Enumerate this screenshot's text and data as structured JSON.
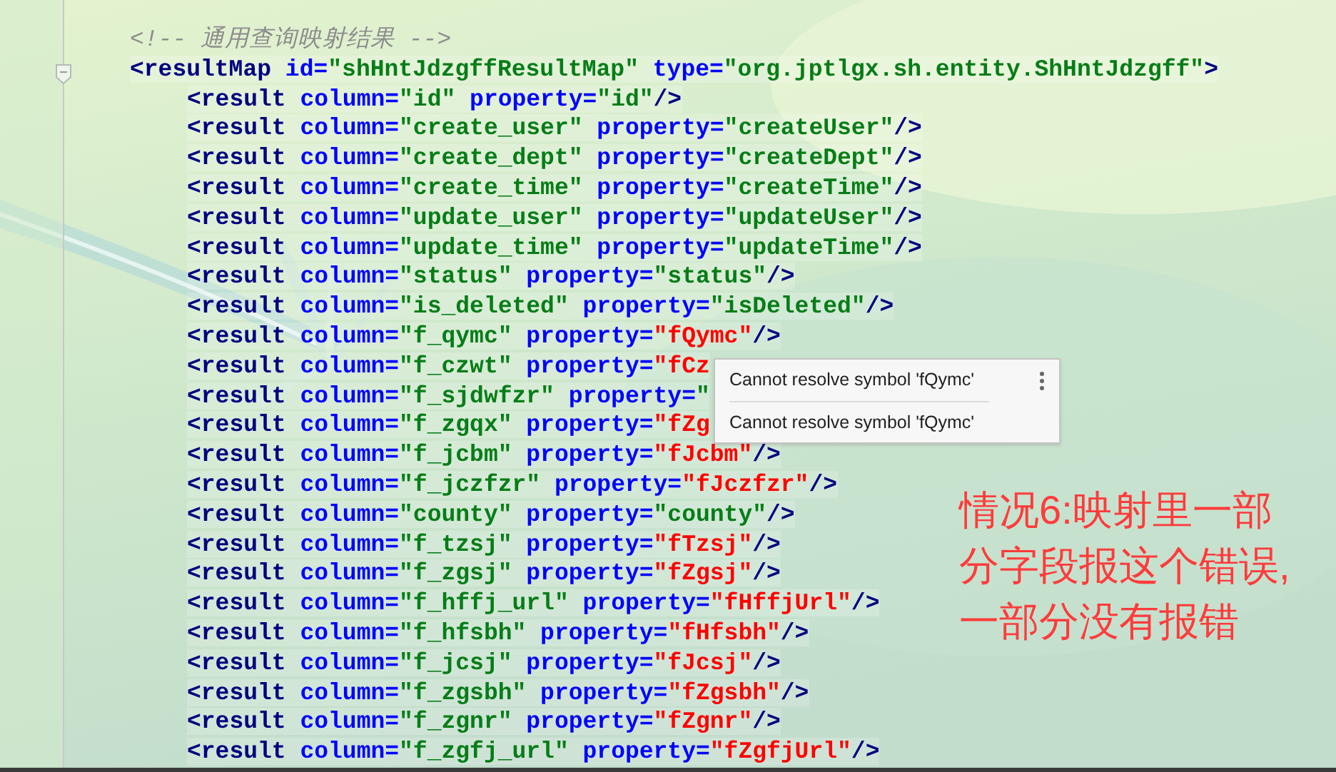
{
  "editor": {
    "comment": "<!-- 通用查询映射结果 -->",
    "result_map": {
      "tokens": [
        {
          "text": "<resultMap",
          "kind": "tag"
        },
        {
          "text": " id=",
          "kind": "attr"
        },
        {
          "text": "\"shHntJdzgffResultMap\"",
          "kind": "str"
        },
        {
          "text": " type=",
          "kind": "attr"
        },
        {
          "text": "\"org.jptlgx.sh.entity.ShHntJdzgff\"",
          "kind": "str"
        },
        {
          "text": ">",
          "kind": "tag"
        }
      ],
      "children": [
        {
          "tokens": [
            {
              "text": "<result",
              "kind": "tag"
            },
            {
              "text": " column=",
              "kind": "attr"
            },
            {
              "text": "\"id\"",
              "kind": "str"
            },
            {
              "text": " property=",
              "kind": "attr"
            },
            {
              "text": "\"id\"",
              "kind": "str"
            },
            {
              "text": "/>",
              "kind": "tag"
            }
          ]
        },
        {
          "tokens": [
            {
              "text": "<result",
              "kind": "tag"
            },
            {
              "text": " column=",
              "kind": "attr"
            },
            {
              "text": "\"create_user\"",
              "kind": "str"
            },
            {
              "text": " property=",
              "kind": "attr"
            },
            {
              "text": "\"createUser\"",
              "kind": "str"
            },
            {
              "text": "/>",
              "kind": "tag"
            }
          ]
        },
        {
          "tokens": [
            {
              "text": "<result",
              "kind": "tag"
            },
            {
              "text": " column=",
              "kind": "attr"
            },
            {
              "text": "\"create_dept\"",
              "kind": "str"
            },
            {
              "text": " property=",
              "kind": "attr"
            },
            {
              "text": "\"createDept\"",
              "kind": "str"
            },
            {
              "text": "/>",
              "kind": "tag"
            }
          ]
        },
        {
          "tokens": [
            {
              "text": "<result",
              "kind": "tag"
            },
            {
              "text": " column=",
              "kind": "attr"
            },
            {
              "text": "\"create_time\"",
              "kind": "str"
            },
            {
              "text": " property=",
              "kind": "attr"
            },
            {
              "text": "\"createTime\"",
              "kind": "str"
            },
            {
              "text": "/>",
              "kind": "tag"
            }
          ]
        },
        {
          "tokens": [
            {
              "text": "<result",
              "kind": "tag"
            },
            {
              "text": " column=",
              "kind": "attr"
            },
            {
              "text": "\"update_user\"",
              "kind": "str"
            },
            {
              "text": " property=",
              "kind": "attr"
            },
            {
              "text": "\"updateUser\"",
              "kind": "str"
            },
            {
              "text": "/>",
              "kind": "tag"
            }
          ]
        },
        {
          "tokens": [
            {
              "text": "<result",
              "kind": "tag"
            },
            {
              "text": " column=",
              "kind": "attr"
            },
            {
              "text": "\"update_time\"",
              "kind": "str"
            },
            {
              "text": " property=",
              "kind": "attr"
            },
            {
              "text": "\"updateTime\"",
              "kind": "str"
            },
            {
              "text": "/>",
              "kind": "tag"
            }
          ]
        },
        {
          "tokens": [
            {
              "text": "<result",
              "kind": "tag"
            },
            {
              "text": " column=",
              "kind": "attr"
            },
            {
              "text": "\"status\"",
              "kind": "str"
            },
            {
              "text": " property=",
              "kind": "attr"
            },
            {
              "text": "\"status\"",
              "kind": "str"
            },
            {
              "text": "/>",
              "kind": "tag"
            }
          ]
        },
        {
          "tokens": [
            {
              "text": "<result",
              "kind": "tag"
            },
            {
              "text": " column=",
              "kind": "attr"
            },
            {
              "text": "\"is_deleted\"",
              "kind": "str"
            },
            {
              "text": " property=",
              "kind": "attr"
            },
            {
              "text": "\"isDeleted\"",
              "kind": "str"
            },
            {
              "text": "/>",
              "kind": "tag"
            }
          ]
        },
        {
          "tokens": [
            {
              "text": "<result",
              "kind": "tag"
            },
            {
              "text": " column=",
              "kind": "attr"
            },
            {
              "text": "\"f_qymc\"",
              "kind": "str"
            },
            {
              "text": " property=",
              "kind": "attr"
            },
            {
              "text": "\"fQymc\"",
              "kind": "err"
            },
            {
              "text": "/>",
              "kind": "tag"
            }
          ]
        },
        {
          "tokens": [
            {
              "text": "<result",
              "kind": "tag"
            },
            {
              "text": " column=",
              "kind": "attr"
            },
            {
              "text": "\"f_czwt\"",
              "kind": "str"
            },
            {
              "text": " property=",
              "kind": "attr"
            },
            {
              "text": "\"fCz",
              "kind": "err"
            }
          ]
        },
        {
          "tokens": [
            {
              "text": "<result",
              "kind": "tag"
            },
            {
              "text": " column=",
              "kind": "attr"
            },
            {
              "text": "\"f_sjdwfzr\"",
              "kind": "str"
            },
            {
              "text": " property=",
              "kind": "attr"
            },
            {
              "text": "\"",
              "kind": "str"
            }
          ]
        },
        {
          "tokens": [
            {
              "text": "<result",
              "kind": "tag"
            },
            {
              "text": " column=",
              "kind": "attr"
            },
            {
              "text": "\"f_zgqx\"",
              "kind": "str"
            },
            {
              "text": " property=",
              "kind": "attr"
            },
            {
              "text": "\"fZg",
              "kind": "err"
            }
          ]
        },
        {
          "tokens": [
            {
              "text": "<result",
              "kind": "tag"
            },
            {
              "text": " column=",
              "kind": "attr"
            },
            {
              "text": "\"f_jcbm\"",
              "kind": "str"
            },
            {
              "text": " property=",
              "kind": "attr"
            },
            {
              "text": "\"fJcbm\"",
              "kind": "err"
            },
            {
              "text": "/>",
              "kind": "tag"
            }
          ]
        },
        {
          "tokens": [
            {
              "text": "<result",
              "kind": "tag"
            },
            {
              "text": " column=",
              "kind": "attr"
            },
            {
              "text": "\"f_jczfzr\"",
              "kind": "str"
            },
            {
              "text": " property=",
              "kind": "attr"
            },
            {
              "text": "\"fJczfzr\"",
              "kind": "err"
            },
            {
              "text": "/>",
              "kind": "tag"
            }
          ]
        },
        {
          "tokens": [
            {
              "text": "<result",
              "kind": "tag"
            },
            {
              "text": " column=",
              "kind": "attr"
            },
            {
              "text": "\"county\"",
              "kind": "str"
            },
            {
              "text": " property=",
              "kind": "attr"
            },
            {
              "text": "\"county\"",
              "kind": "str"
            },
            {
              "text": "/>",
              "kind": "tag"
            }
          ]
        },
        {
          "tokens": [
            {
              "text": "<result",
              "kind": "tag"
            },
            {
              "text": " column=",
              "kind": "attr"
            },
            {
              "text": "\"f_tzsj\"",
              "kind": "str"
            },
            {
              "text": " property=",
              "kind": "attr"
            },
            {
              "text": "\"fTzsj\"",
              "kind": "err"
            },
            {
              "text": "/>",
              "kind": "tag"
            }
          ]
        },
        {
          "tokens": [
            {
              "text": "<result",
              "kind": "tag"
            },
            {
              "text": " column=",
              "kind": "attr"
            },
            {
              "text": "\"f_zgsj\"",
              "kind": "str"
            },
            {
              "text": " property=",
              "kind": "attr"
            },
            {
              "text": "\"fZgsj\"",
              "kind": "err"
            },
            {
              "text": "/>",
              "kind": "tag"
            }
          ]
        },
        {
          "tokens": [
            {
              "text": "<result",
              "kind": "tag"
            },
            {
              "text": " column=",
              "kind": "attr"
            },
            {
              "text": "\"f_hffj_url\"",
              "kind": "str"
            },
            {
              "text": " property=",
              "kind": "attr"
            },
            {
              "text": "\"fHffjUrl\"",
              "kind": "err"
            },
            {
              "text": "/>",
              "kind": "tag"
            }
          ]
        },
        {
          "tokens": [
            {
              "text": "<result",
              "kind": "tag"
            },
            {
              "text": " column=",
              "kind": "attr"
            },
            {
              "text": "\"f_hfsbh\"",
              "kind": "str"
            },
            {
              "text": " property=",
              "kind": "attr"
            },
            {
              "text": "\"fHfsbh\"",
              "kind": "err"
            },
            {
              "text": "/>",
              "kind": "tag"
            }
          ]
        },
        {
          "tokens": [
            {
              "text": "<result",
              "kind": "tag"
            },
            {
              "text": " column=",
              "kind": "attr"
            },
            {
              "text": "\"f_jcsj\"",
              "kind": "str"
            },
            {
              "text": " property=",
              "kind": "attr"
            },
            {
              "text": "\"fJcsj\"",
              "kind": "err"
            },
            {
              "text": "/>",
              "kind": "tag"
            }
          ]
        },
        {
          "tokens": [
            {
              "text": "<result",
              "kind": "tag"
            },
            {
              "text": " column=",
              "kind": "attr"
            },
            {
              "text": "\"f_zgsbh\"",
              "kind": "str"
            },
            {
              "text": " property=",
              "kind": "attr"
            },
            {
              "text": "\"fZgsbh\"",
              "kind": "err"
            },
            {
              "text": "/>",
              "kind": "tag"
            }
          ]
        },
        {
          "tokens": [
            {
              "text": "<result",
              "kind": "tag"
            },
            {
              "text": " column=",
              "kind": "attr"
            },
            {
              "text": "\"f_zgnr\"",
              "kind": "str"
            },
            {
              "text": " property=",
              "kind": "attr"
            },
            {
              "text": "\"fZgnr\"",
              "kind": "err"
            },
            {
              "text": "/>",
              "kind": "tag"
            }
          ]
        },
        {
          "tokens": [
            {
              "text": "<result",
              "kind": "tag"
            },
            {
              "text": " column=",
              "kind": "attr"
            },
            {
              "text": "\"f_zgfj_url\"",
              "kind": "str"
            },
            {
              "text": " property=",
              "kind": "attr"
            },
            {
              "text": "\"fZgfjUrl\"",
              "kind": "err"
            },
            {
              "text": "/>",
              "kind": "tag"
            }
          ]
        }
      ]
    }
  },
  "tooltip": {
    "messages": [
      "Cannot resolve symbol 'fQymc'",
      "Cannot resolve symbol 'fQymc'"
    ]
  },
  "annotation": {
    "lines": [
      "情况6:映射里一部",
      "分字段报这个错误,",
      "一部分没有报错"
    ]
  }
}
